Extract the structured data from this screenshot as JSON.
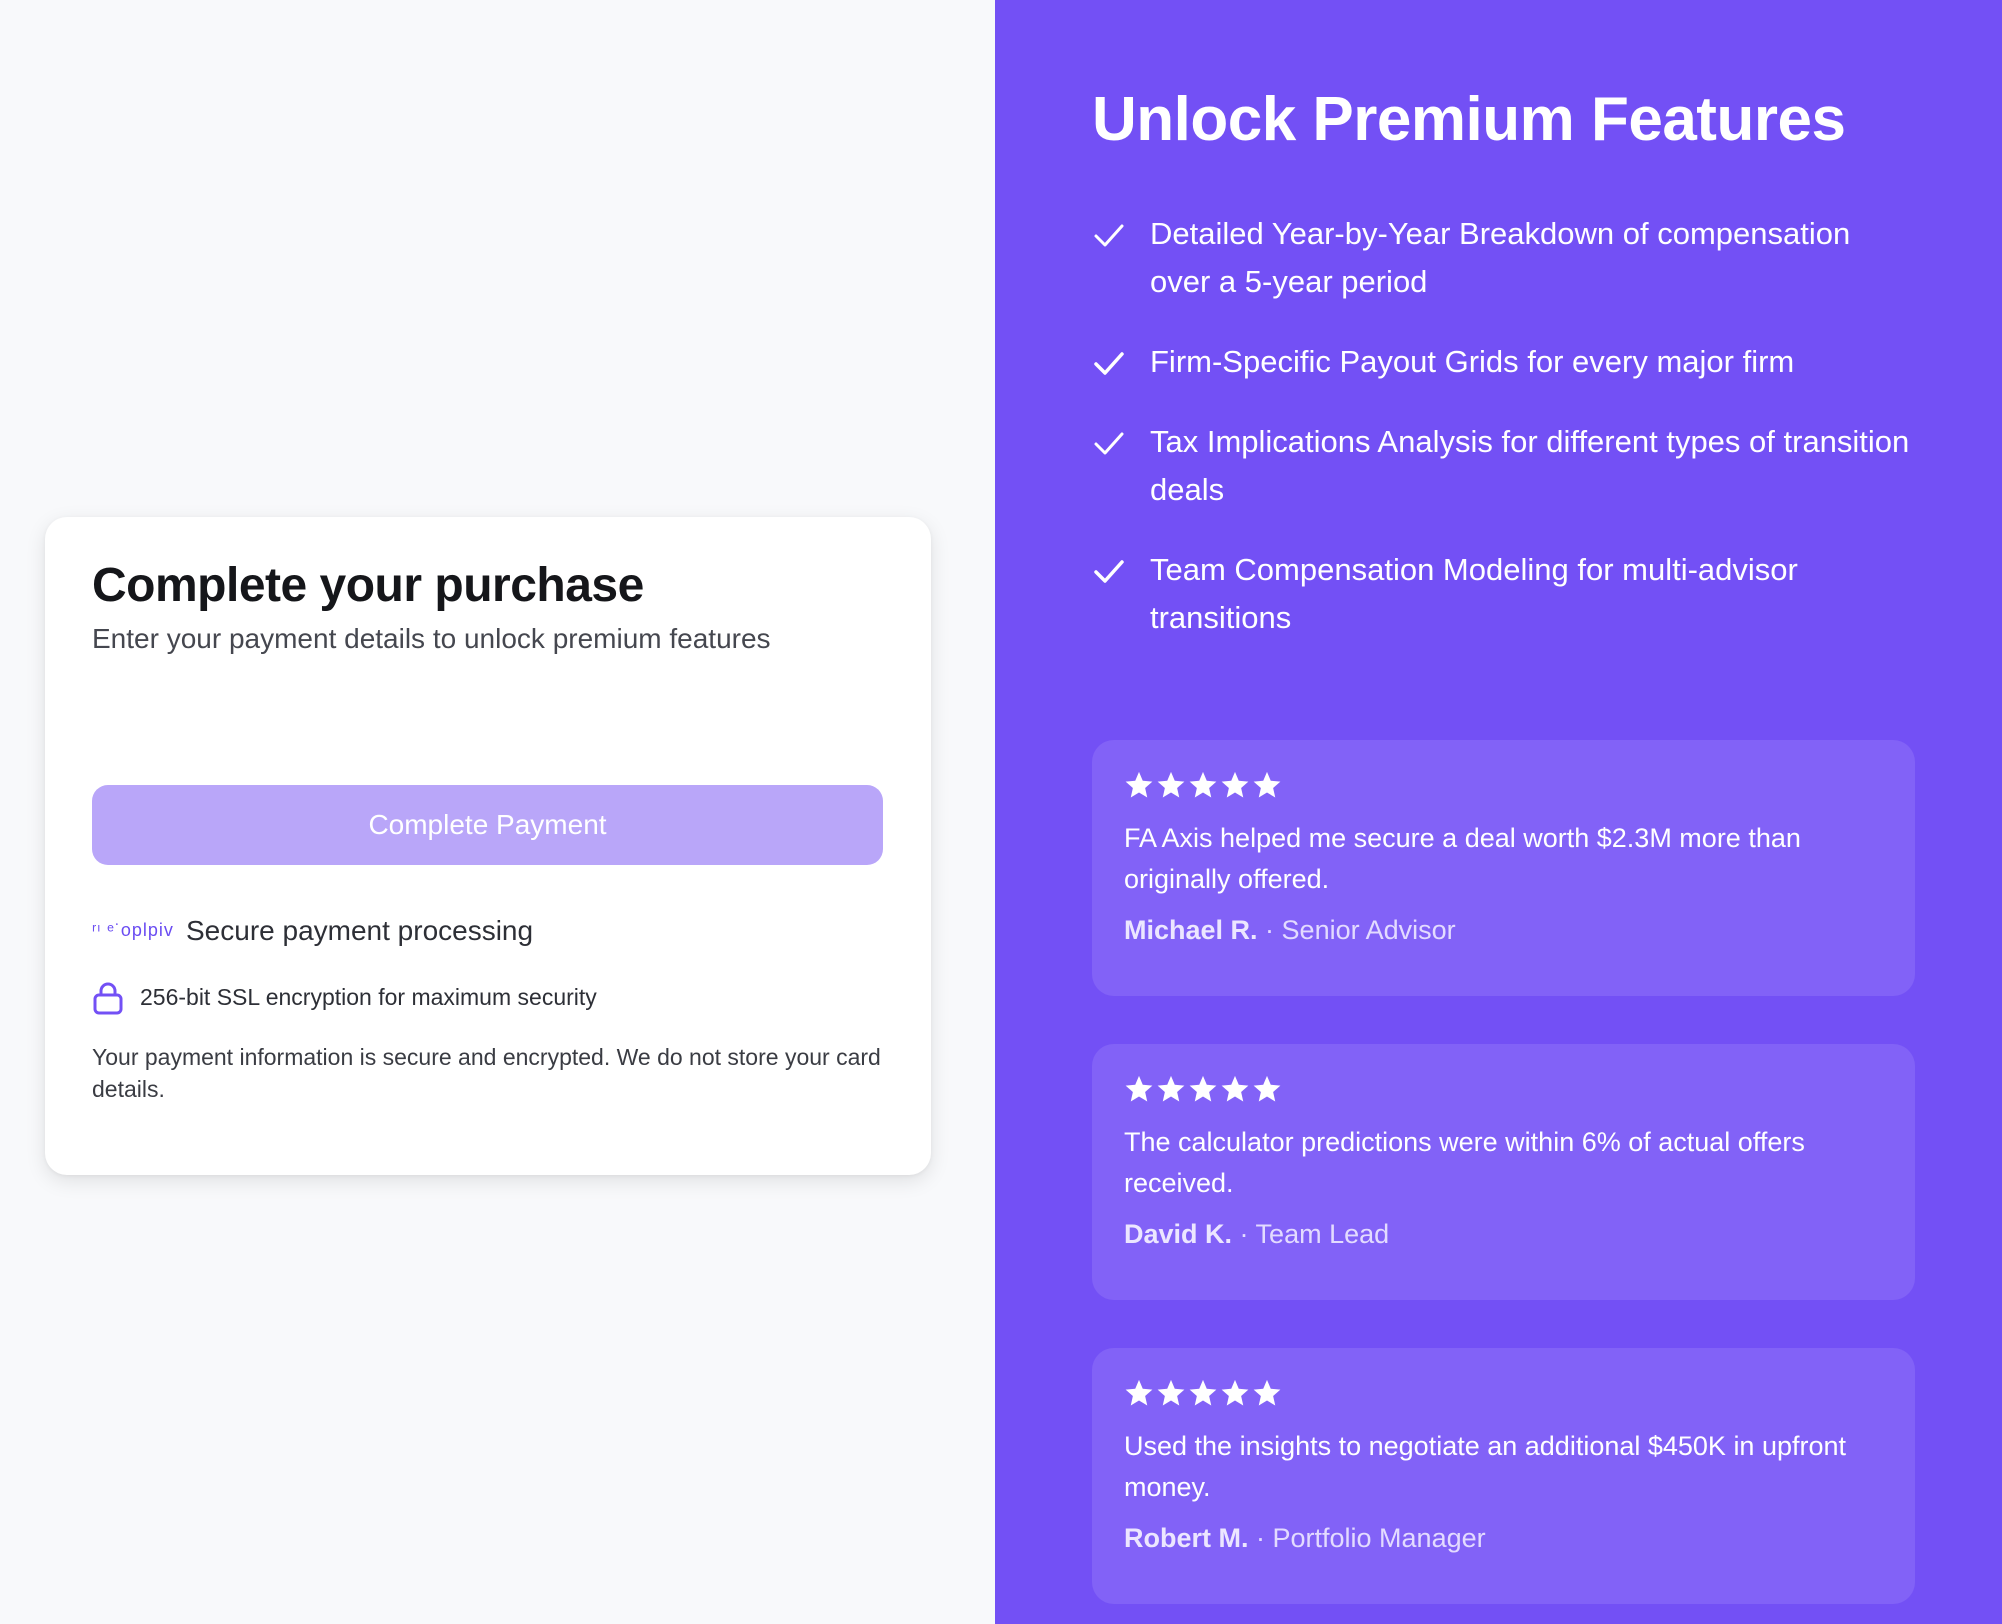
{
  "checkout": {
    "title": "Complete your purchase",
    "subtitle": "Enter your payment details to unlock premium features",
    "pay_button_label": "Complete Payment",
    "provider_logo_text": "ʳᶦ ᵉ͘ oplpiv",
    "secure_text": "Secure payment processing",
    "ssl_text": "256-bit SSL encryption for maximum security",
    "disclaimer": "Your payment information is secure and encrypted. We do not store your card details."
  },
  "premium": {
    "title": "Unlock Premium Features",
    "features": [
      {
        "text": "Detailed Year-by-Year Breakdown of compensation over a 5-year period"
      },
      {
        "text": "Firm-Specific Payout Grids for every major firm"
      },
      {
        "text": "Tax Implications Analysis for different types of transition deals"
      },
      {
        "text": "Team Compensation Modeling for multi-advisor transitions"
      }
    ],
    "testimonials": [
      {
        "rating": 5,
        "quote": "FA Axis helped me secure a deal worth $2.3M more than originally offered.",
        "name": "Michael R.",
        "separator": " · ",
        "role": "Senior Advisor"
      },
      {
        "rating": 5,
        "quote": "The calculator predictions were within 6% of actual offers received.",
        "name": "David K.",
        "separator": " · ",
        "role": "Team Lead"
      },
      {
        "rating": 5,
        "quote": "Used the insights to negotiate an additional $450K in upfront money.",
        "name": "Robert M.",
        "separator": " · ",
        "role": "Portfolio Manager"
      }
    ]
  },
  "colors": {
    "accent": "#7350f5",
    "button_disabled": "#b9a6f9",
    "testimonial_card": "#8262f7"
  },
  "icons": {
    "check": "check-icon",
    "lock": "lock-icon",
    "star": "star-icon"
  }
}
